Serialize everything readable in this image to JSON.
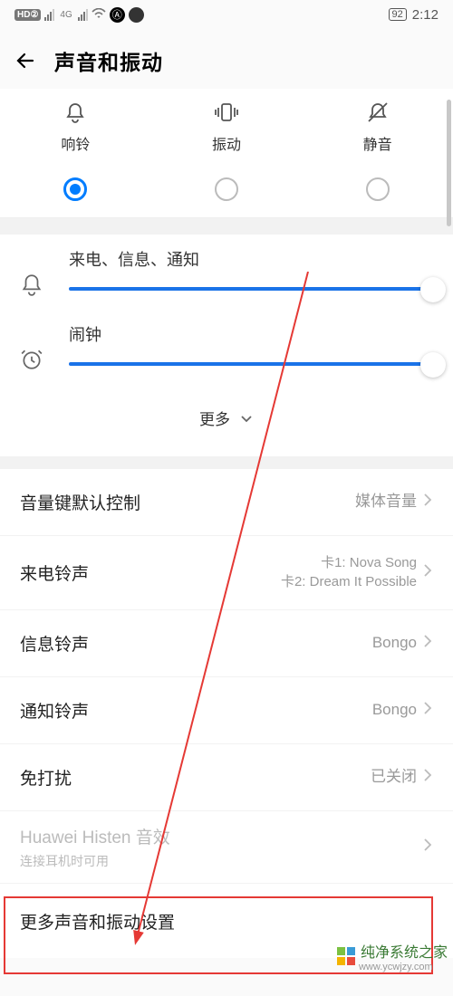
{
  "status": {
    "hd": "HD②",
    "sig": "4G",
    "battery": "92",
    "time": "2:12"
  },
  "header": {
    "title": "声音和振动"
  },
  "modes": [
    {
      "label": "响铃",
      "selected": true
    },
    {
      "label": "振动",
      "selected": false
    },
    {
      "label": "静音",
      "selected": false
    }
  ],
  "sliders": {
    "incoming": "来电、信息、通知",
    "alarm": "闹钟"
  },
  "more": "更多",
  "settings": {
    "volume_key": {
      "label": "音量键默认控制",
      "value": "媒体音量"
    },
    "call_tone": {
      "label": "来电铃声",
      "v1": "卡1: Nova Song",
      "v2": "卡2: Dream It Possible"
    },
    "msg_tone": {
      "label": "信息铃声",
      "value": "Bongo"
    },
    "notif_tone": {
      "label": "通知铃声",
      "value": "Bongo"
    },
    "dnd": {
      "label": "免打扰",
      "value": "已关闭"
    },
    "histen": {
      "label": "Huawei Histen 音效",
      "sub": "连接耳机时可用"
    },
    "more_settings": {
      "label": "更多声音和振动设置"
    }
  },
  "watermark": {
    "text": "纯净系统之家",
    "url": "www.ycwjzy.com"
  }
}
